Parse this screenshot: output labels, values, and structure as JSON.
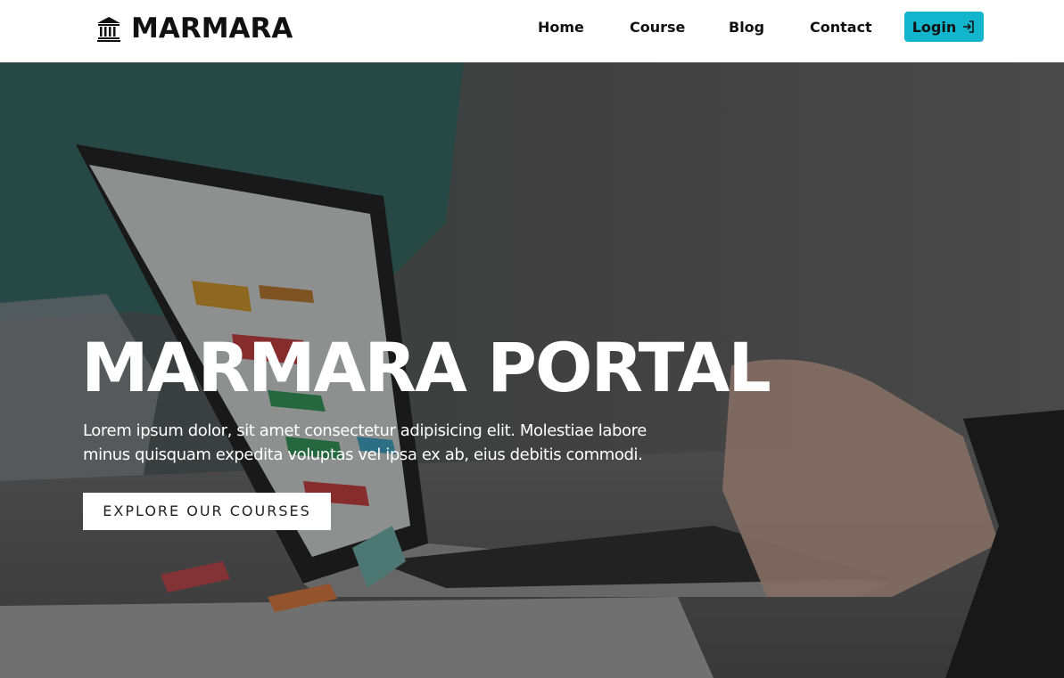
{
  "navbar": {
    "brand": {
      "name": "MARMARA",
      "icon": "bank-building-icon"
    },
    "links": [
      {
        "label": "Home"
      },
      {
        "label": "Course"
      },
      {
        "label": "Blog"
      },
      {
        "label": "Contact"
      }
    ],
    "login": {
      "label": "Login",
      "icon": "login-arrow-icon",
      "color": "#12b5cc"
    }
  },
  "hero": {
    "title": "MARMARA PORTAL",
    "description": "Lorem ipsum dolor, sit amet consectetur adipisicing elit. Molestiae labore minus quisquam expedita voluptas vel ipsa ex ab, eius debitis commodi.",
    "cta_label": "EXPLORE OUR COURSES"
  }
}
